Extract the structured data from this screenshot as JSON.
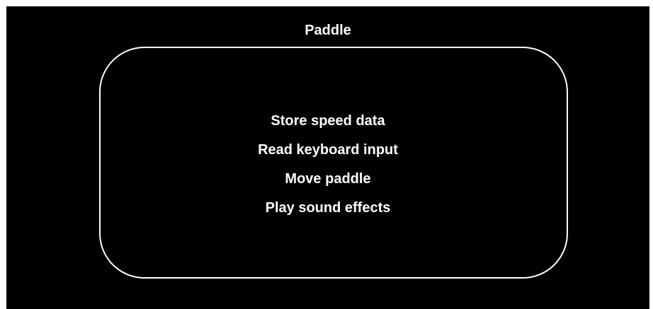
{
  "diagram": {
    "title": "Paddle",
    "items": [
      "Store speed data",
      "Read keyboard input",
      "Move paddle",
      "Play sound effects"
    ]
  },
  "colors": {
    "background": "#000000",
    "text": "#ffffff",
    "border": "#ffffff"
  }
}
